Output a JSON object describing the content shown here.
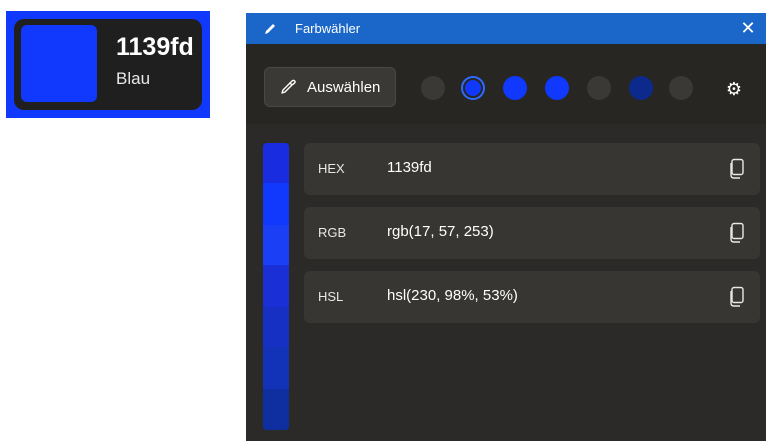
{
  "preview": {
    "hex": "1139fd",
    "name": "Blau",
    "color": "#1139fd"
  },
  "window": {
    "title": "Farbwähler",
    "close_icon": "close-icon",
    "titlebar_color": "#1a67c9"
  },
  "toolbar": {
    "pick_label": "Auswählen",
    "pick_icon": "eyedropper-icon",
    "settings_icon": "gear-icon",
    "swatches": [
      {
        "color": "#3a3936",
        "selected": false
      },
      {
        "color": "#1139fd",
        "selected": true
      },
      {
        "color": "#1139fd",
        "selected": false
      },
      {
        "color": "#1139fd",
        "selected": false
      },
      {
        "color": "#3a3936",
        "selected": false
      },
      {
        "color": "#0c2a8c",
        "selected": false
      },
      {
        "color": "#3a3936",
        "selected": false
      }
    ]
  },
  "formats": [
    {
      "label": "HEX",
      "value": "1139fd",
      "icon": "copy-icon"
    },
    {
      "label": "RGB",
      "value": "rgb(17, 57, 253)",
      "icon": "copy-icon"
    },
    {
      "label": "HSL",
      "value": "hsl(230, 98%, 53%)",
      "icon": "copy-icon"
    }
  ],
  "gradient": [
    "#1a2ce0",
    "#1139fd",
    "#1a3ff5",
    "#1a2fd6",
    "#1530c2",
    "#1232b8",
    "#0f2ea0"
  ]
}
